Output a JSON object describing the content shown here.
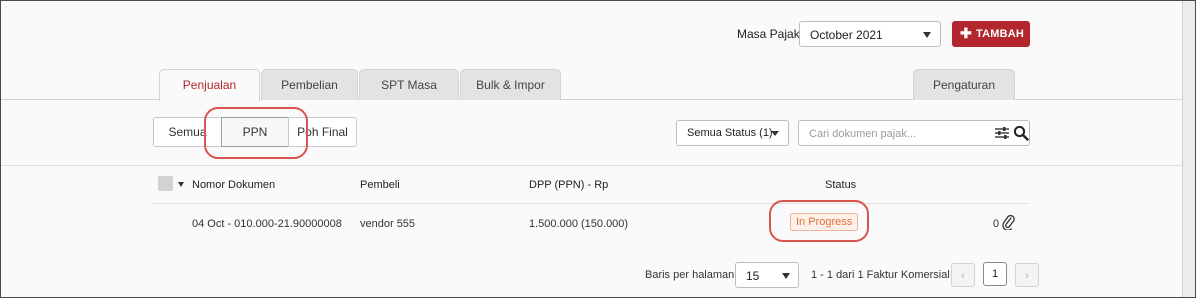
{
  "header": {
    "period_label": "Masa Pajak",
    "period_value": "October  2021",
    "add_button_label": "TAMBAH",
    "accent_color": "#b3262d"
  },
  "tabs": [
    {
      "label": "Penjualan",
      "active": true
    },
    {
      "label": "Pembelian",
      "active": false
    },
    {
      "label": "SPT Masa",
      "active": false
    },
    {
      "label": "Bulk & Impor",
      "active": false
    }
  ],
  "settings_tab": {
    "label": "Pengaturan"
  },
  "segments": [
    {
      "label": "Semua",
      "active": false
    },
    {
      "label": "PPN",
      "active": true
    },
    {
      "label": "Poh Final",
      "active": false
    }
  ],
  "filters": {
    "status_value": "Semua Status (1)",
    "search_placeholder": "Cari dokumen pajak..."
  },
  "table": {
    "columns": [
      "Nomor Dokumen",
      "Pembeli",
      "DPP (PPN) - Rp",
      "Status"
    ],
    "rows": [
      {
        "nomor": "04 Oct - 010.000-21.90000008",
        "pembeli": "vendor 555",
        "dpp": "1.500.000 (150.000)",
        "status": "In Progress",
        "attachments": "0"
      }
    ]
  },
  "pagination": {
    "per_page_label": "Baris per halaman:",
    "per_page_value": "15",
    "info": "1 - 1 dari 1 Faktur Komersial",
    "current_page": "1",
    "prev_icon": "chevron-left-icon",
    "next_icon": "chevron-right-icon"
  },
  "status_color": "#e0703d",
  "annotation_color": "#d9534f"
}
